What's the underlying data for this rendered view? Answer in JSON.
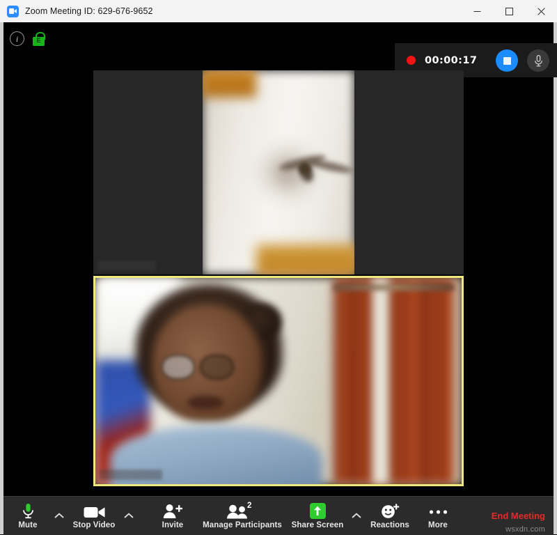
{
  "window": {
    "title": "Zoom Meeting ID: 629-676-9652",
    "app_icon": "zoom-camera-icon",
    "controls": {
      "minimize": "minimize-icon",
      "maximize": "maximize-icon",
      "close": "close-icon"
    }
  },
  "status": {
    "info_icon": "info-icon",
    "info_glyph": "i",
    "encryption_icon": "green-lock-icon",
    "encryption_glyph": "E"
  },
  "recording_bar": {
    "indicator": "record-dot-icon",
    "elapsed": "00:00:17",
    "stop_button": "stop-recording-icon",
    "mic_button": "microphone-icon",
    "accent_color": "#1a8cff",
    "record_color": "#f01414"
  },
  "video": {
    "tiles": [
      {
        "id": "participant-video-top",
        "active_speaker": false,
        "name_label": "",
        "description": "blurred ceiling fan on white wall, letterboxed"
      },
      {
        "id": "participant-video-active",
        "active_speaker": true,
        "name_label": "",
        "border_color": "#efe87e",
        "description": "blurred webcam of person with glasses, orange curtain"
      }
    ]
  },
  "toolbar": {
    "items": [
      {
        "name": "mute",
        "label": "Mute",
        "icon": "microphone-icon",
        "has_chevron": true
      },
      {
        "name": "stop-video",
        "label": "Stop Video",
        "icon": "video-camera-icon",
        "has_chevron": true
      },
      {
        "name": "invite",
        "label": "Invite",
        "icon": "person-add-icon",
        "has_chevron": false
      },
      {
        "name": "manage-participants",
        "label": "Manage Participants",
        "icon": "people-icon",
        "badge": "2",
        "has_chevron": false
      },
      {
        "name": "share-screen",
        "label": "Share Screen",
        "icon": "share-arrow-icon",
        "has_chevron": true
      },
      {
        "name": "reactions",
        "label": "Reactions",
        "icon": "smiley-plus-icon",
        "has_chevron": false
      },
      {
        "name": "more",
        "label": "More",
        "icon": "ellipsis-icon",
        "has_chevron": false
      }
    ],
    "end_meeting": {
      "label": "End Meeting",
      "color": "#e22b2b"
    },
    "mic_color": "#2ecc2e",
    "share_color": "#2ecc2e"
  },
  "watermark": "wsxdn.com"
}
